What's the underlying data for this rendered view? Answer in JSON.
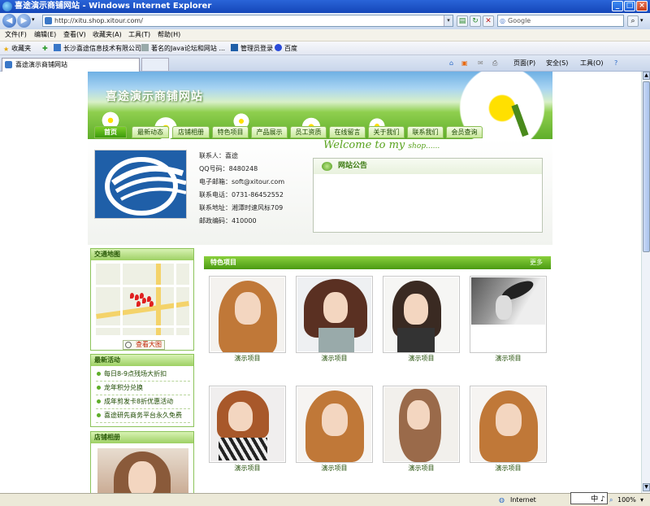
{
  "window": {
    "title": "喜途演示商铺网站 - Windows Internet Explorer",
    "minimize": "_",
    "maximize": "□",
    "close": "×"
  },
  "address_bar": {
    "url": "http://xitu.shop.xitour.com/",
    "back": "◀",
    "forward": "▶",
    "search_placeholder": "Google",
    "refresh": "↻",
    "stop": "✕",
    "go": "→",
    "search_go": "⌕"
  },
  "menu": [
    "文件(F)",
    "编辑(E)",
    "查看(V)",
    "收藏夹(A)",
    "工具(T)",
    "帮助(H)"
  ],
  "favorites": {
    "label": "收藏夹",
    "items": [
      "长沙喜途信息技术有限公司",
      "著名的Java论坛和网站 ...",
      "管理员登录",
      "百度"
    ]
  },
  "tab": {
    "title": "喜途演示商铺网站",
    "tools": [
      "页面(P)",
      "安全(S)",
      "工具(O)"
    ]
  },
  "site": {
    "title": "喜途演示商铺网站",
    "nav": [
      "首页",
      "最新动态",
      "店铺相册",
      "特色项目",
      "产品展示",
      "员工资质",
      "在线留言",
      "关于我们",
      "联系我们",
      "会员查询"
    ],
    "contact": [
      "联系人：喜途",
      "QQ号码：8480248",
      "电子邮箱：soft@xitour.com",
      "联系电话：0731-86452552",
      "联系地址：湘潭时速风标709",
      "邮政编码：410000"
    ],
    "welcome": "Welcome to my",
    "welcome_small": "shop......",
    "notice_title": "网站公告",
    "map_title": "交通地图",
    "map_button": "查看大图",
    "news_title": "最新活动",
    "news": [
      "每日8-9点残场大折扣",
      "龙年积分兑换",
      "成年剪发卡8折优惠活动",
      "喜途研先商务平台永久免费"
    ],
    "album_title": "店铺相册",
    "featured_title": "特色项目",
    "featured_more": "更多",
    "items": [
      "演示项目",
      "演示项目",
      "演示项目",
      "演示项目",
      "演示项目",
      "演示项目",
      "演示项目",
      "演示项目"
    ]
  },
  "status": {
    "zone": "Internet",
    "ime": "中 ♪ ✧",
    "zoom": "100%"
  },
  "colors": {
    "accent_green": "#5fae2a",
    "ie_blue": "#1446b8"
  }
}
